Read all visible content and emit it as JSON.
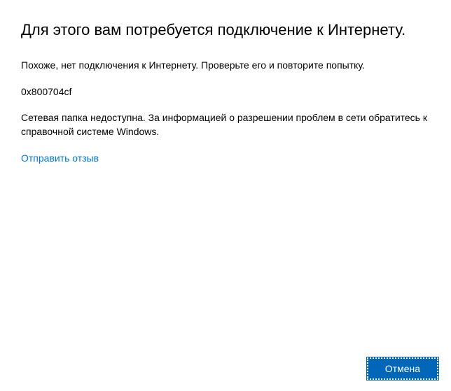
{
  "dialog": {
    "title": "Для этого вам потребуется подключение к Интернету.",
    "message": "Похоже, нет подключения к Интернету. Проверьте его и повторите попытку.",
    "error_code": "0x800704cf",
    "description": "Сетевая папка недоступна. За информацией о разрешении проблем в сети обратитесь к справочной системе Windows.",
    "feedback_link": "Отправить отзыв",
    "cancel_label": "Отмена"
  }
}
